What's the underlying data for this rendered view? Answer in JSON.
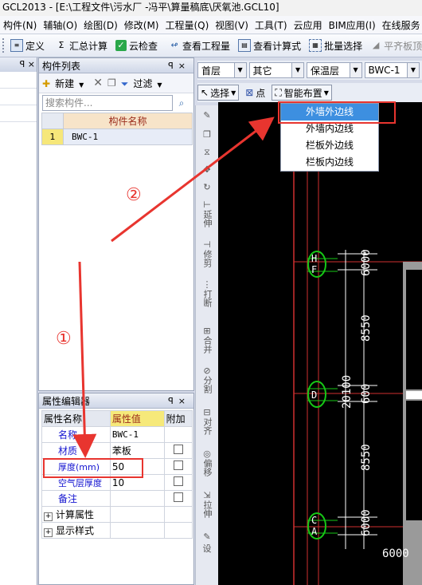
{
  "title": "GCL2013 - [E:\\工程文件\\污水厂 -冯平\\算量稿底\\厌氧池.GCL10]",
  "menu": [
    "构件(N)",
    "辅轴(O)",
    "绘图(D)",
    "修改(M)",
    "工程量(Q)",
    "视图(V)",
    "工具(T)",
    "云应用",
    "BIM应用(I)",
    "在线服务"
  ],
  "toolbar": {
    "define": "定义",
    "sum": "汇总计算",
    "cloud_check": "云检查",
    "view_qty": "查看工程量",
    "view_formula": "查看计算式",
    "batch_select": "批量选择",
    "level_board": "平齐板顶"
  },
  "left_panel": {
    "pin": "ꟼ ×"
  },
  "component_list": {
    "title": "构件列表",
    "new_label": "新建",
    "filter_label": "过滤",
    "search_placeholder": "搜索构件...",
    "column_header": "构件名称",
    "rows": [
      {
        "index": "1",
        "name": "BWC-1"
      }
    ]
  },
  "property_editor": {
    "title": "属性编辑器",
    "headers": {
      "name": "属性名称",
      "value": "属性值",
      "extra": "附加"
    },
    "rows": [
      {
        "name": "名称",
        "value": "BWC-1"
      },
      {
        "name": "材质",
        "value": "苯板"
      },
      {
        "name": "厚度(mm)",
        "value": "50"
      },
      {
        "name": "空气层厚度",
        "value": "10"
      },
      {
        "name": "备注",
        "value": ""
      }
    ],
    "groups": [
      "计算属性",
      "显示样式"
    ]
  },
  "selectors": {
    "floor": "首层",
    "category": "其它",
    "type": "保温层",
    "component": "BWC-1"
  },
  "actions": {
    "select": "选择",
    "point": "点",
    "smart_layout": "智能布置"
  },
  "dropdown_items": [
    "外墙外边线",
    "外墙内边线",
    "栏板外边线",
    "栏板内边线"
  ],
  "vertical_tools": [
    "延伸",
    "修剪",
    "打断",
    "合并",
    "分割",
    "对齐",
    "偏移",
    "拉伸",
    "设"
  ],
  "drawing": {
    "axis_labels": [
      "H",
      "F",
      "D",
      "C",
      "A"
    ],
    "dims_vertical": [
      "6000",
      "8550",
      "600",
      "8550",
      "6000"
    ],
    "total": "20100",
    "bottom_dim": "6000"
  },
  "annotations": {
    "one": "①",
    "two": "②"
  },
  "colors": {
    "arrow": "#e8352f",
    "highlight": "#3d8fe0",
    "axis": "#16c816"
  }
}
